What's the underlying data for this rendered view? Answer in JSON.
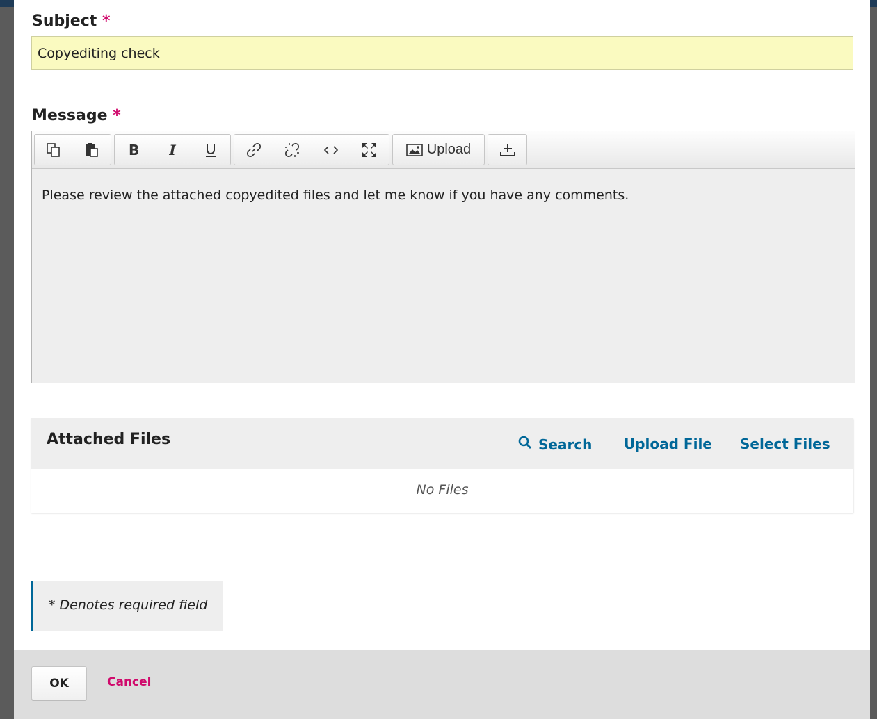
{
  "form": {
    "subject": {
      "label": "Subject",
      "required_mark": "*",
      "value": "Copyediting check"
    },
    "message": {
      "label": "Message",
      "required_mark": "*",
      "toolbar": {
        "buttons": [
          "copy-icon",
          "paste-icon",
          "bold-icon",
          "italic-icon",
          "underline-icon",
          "link-icon",
          "unlink-icon",
          "code-icon",
          "fullscreen-icon",
          "image-icon",
          "insert-icon"
        ],
        "bold_label": "B",
        "italic_label": "I",
        "upload_label": "Upload"
      },
      "content": "Please review the attached copyedited files and let me know if you have any comments."
    },
    "attached_files": {
      "title": "Attached Files",
      "search_label": "Search",
      "upload_label": "Upload File",
      "select_label": "Select Files",
      "empty_text": "No Files"
    },
    "required_note": "* Denotes required field"
  },
  "footer": {
    "ok_label": "OK",
    "cancel_label": "Cancel"
  },
  "colors": {
    "accent": "#006798",
    "required": "#d00a6c",
    "subject_bg": "#fafac0"
  }
}
